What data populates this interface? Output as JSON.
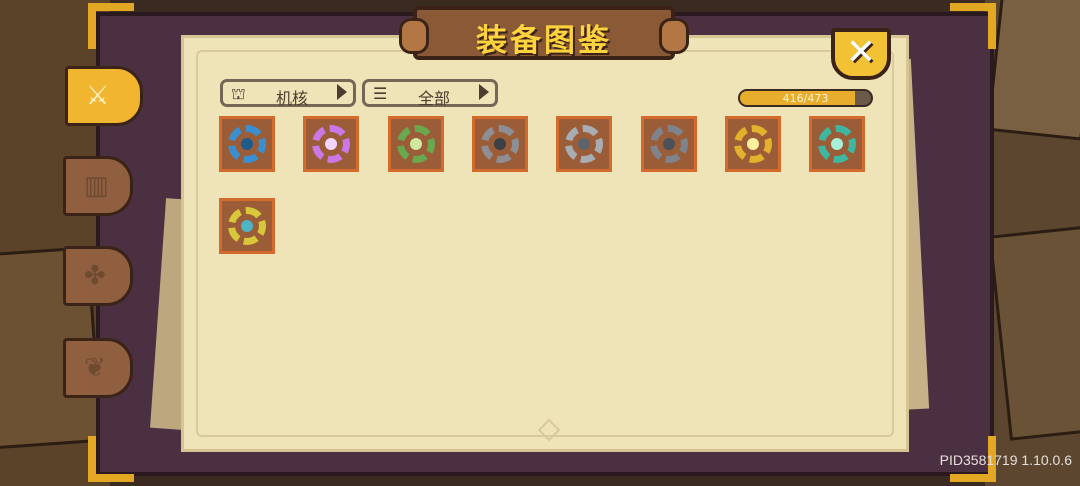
{
  "title": "装备图鉴",
  "close_label": "✕",
  "tabs": [
    {
      "name": "weapon",
      "icon": "sword-icon",
      "glyph": "⚔",
      "active": true
    },
    {
      "name": "armor",
      "icon": "armor-icon",
      "glyph": "▥",
      "active": false
    },
    {
      "name": "accessory",
      "icon": "clover-icon",
      "glyph": "✤",
      "active": false
    },
    {
      "name": "shell",
      "icon": "shell-icon",
      "glyph": "❦",
      "active": false
    }
  ],
  "filters": {
    "type": {
      "label": "机核",
      "icon": "machine-icon"
    },
    "category": {
      "label": "全部",
      "icon": "list-icon"
    }
  },
  "progress": {
    "text": "416/473",
    "current": 416,
    "total": 473
  },
  "items": [
    {
      "name": "blue-core",
      "color": "#3a8fd0",
      "core": "#1e5a8a"
    },
    {
      "name": "purple-core",
      "color": "#c978e6",
      "core": "#f2d6ff"
    },
    {
      "name": "green-core",
      "color": "#6aa84f",
      "core": "#cfe8a0"
    },
    {
      "name": "steel-ring-core",
      "color": "#8d8f95",
      "core": "#3b3f46"
    },
    {
      "name": "twin-gear-core",
      "color": "#a8acb3",
      "core": "#5f646c"
    },
    {
      "name": "iron-gear-core",
      "color": "#7e838c",
      "core": "#4c5058"
    },
    {
      "name": "gold-core",
      "color": "#e3b12b",
      "core": "#fff0a0"
    },
    {
      "name": "emerald-core",
      "color": "#3fb6a0",
      "core": "#a9f0d8"
    },
    {
      "name": "aqua-gold-core",
      "color": "#d8c73a",
      "core": "#4fb3c6"
    }
  ],
  "version": "PID3581719 1.10.0.6"
}
